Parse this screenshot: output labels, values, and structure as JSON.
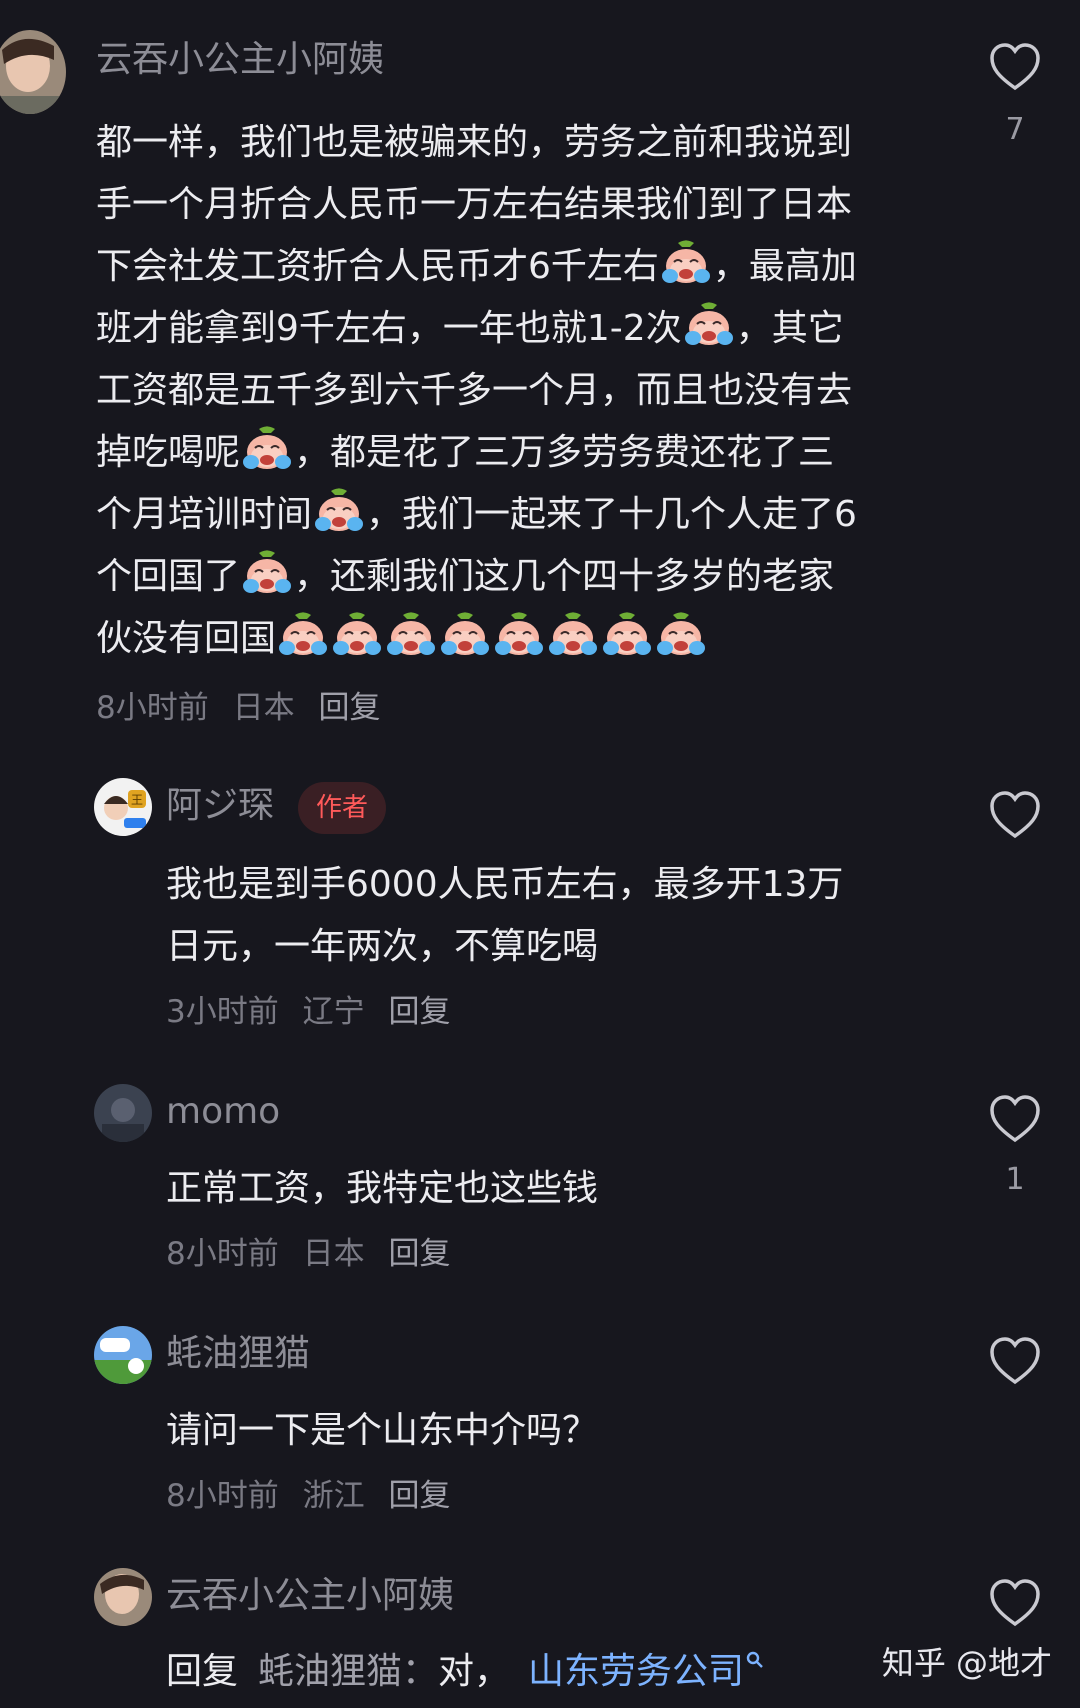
{
  "comments": [
    {
      "username": "云吞小公主小阿姨",
      "body_lines": [
        [
          "都一样，我们也是被骗来的，劳务之前和我说到"
        ],
        [
          "手一个月折合人民币一万左右结果我们到了日本"
        ],
        [
          "下会社发工资折合人民币才6千左右",
          "emoji",
          "，最高加"
        ],
        [
          "班才能拿到9千左右，一年也就1-2次",
          "emoji",
          "，其它"
        ],
        [
          "工资都是五千多到六千多一个月，而且也没有去"
        ],
        [
          "掉吃喝呢",
          "emoji",
          "，都是花了三万多劳务费还花了三"
        ],
        [
          "个月培训时间",
          "emoji",
          "，我们一起来了十几个人走了6"
        ],
        [
          "个回国了",
          "emoji",
          "，还剩我们这几个四十多岁的老家"
        ],
        [
          "伙没有回国",
          "emoji",
          "emoji",
          "emoji",
          "emoji",
          "emoji",
          "emoji",
          "emoji",
          "emoji"
        ]
      ],
      "time": "8小时前",
      "location": "日本",
      "reply_label": "回复",
      "likes": "7"
    },
    {
      "username": "阿ジ琛",
      "badge": "作者",
      "body_lines": [
        [
          "我也是到手6000人民币左右，最多开13万"
        ],
        [
          "日元，一年两次，不算吃喝"
        ]
      ],
      "time": "3小时前",
      "location": "辽宁",
      "reply_label": "回复",
      "likes": ""
    },
    {
      "username": "momo",
      "body_lines": [
        [
          "正常工资，我特定也这些钱"
        ]
      ],
      "time": "8小时前",
      "location": "日本",
      "reply_label": "回复",
      "likes": "1"
    },
    {
      "username": "蚝油狸猫",
      "body_lines": [
        [
          "请问一下是个山东中介吗？"
        ]
      ],
      "time": "8小时前",
      "location": "浙江",
      "reply_label": "回复",
      "likes": ""
    },
    {
      "username": "云吞小公主小阿姨",
      "reply_word": "回复",
      "reply_target": "蚝油狸猫：",
      "reply_text": "对，",
      "reply_link": "山东劳务公司",
      "likes": ""
    }
  ],
  "icons": {
    "like": "heart-outline-icon",
    "emoji": "crying-face-emoji",
    "search": "search-icon"
  },
  "watermark": "知乎 @地才",
  "colors": {
    "background": "#17171e",
    "author_badge": "#ff5a5a",
    "link": "#7db3ff"
  }
}
